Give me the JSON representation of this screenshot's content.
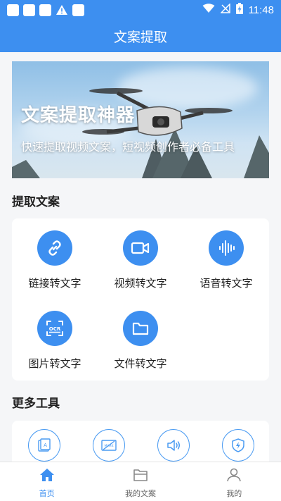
{
  "status_bar": {
    "time": "11:48"
  },
  "app_bar": {
    "title": "文案提取"
  },
  "banner": {
    "title": "文案提取神器",
    "subtitle": "快速提取视频文案，短视频创作者必备工具"
  },
  "extract_section": {
    "title": "提取文案",
    "tools": [
      {
        "label": "链接转文字",
        "icon": "link-icon"
      },
      {
        "label": "视频转文字",
        "icon": "video-camera-icon"
      },
      {
        "label": "语音转文字",
        "icon": "audio-wave-icon"
      },
      {
        "label": "图片转文字",
        "icon": "ocr-scan-icon"
      },
      {
        "label": "文件转文字",
        "icon": "folder-icon"
      }
    ]
  },
  "more_section": {
    "title": "更多工具",
    "icons": [
      "text-image-icon",
      "watermark-remove-icon",
      "speaker-icon",
      "shield-bolt-icon"
    ]
  },
  "tab_bar": {
    "tabs": [
      {
        "label": "首页",
        "icon": "home-icon",
        "active": true
      },
      {
        "label": "我的文案",
        "icon": "folder-tab-icon",
        "active": false
      },
      {
        "label": "我的",
        "icon": "user-icon",
        "active": false
      }
    ]
  },
  "colors": {
    "primary": "#3d8ff0",
    "background": "#f5f6f8"
  }
}
